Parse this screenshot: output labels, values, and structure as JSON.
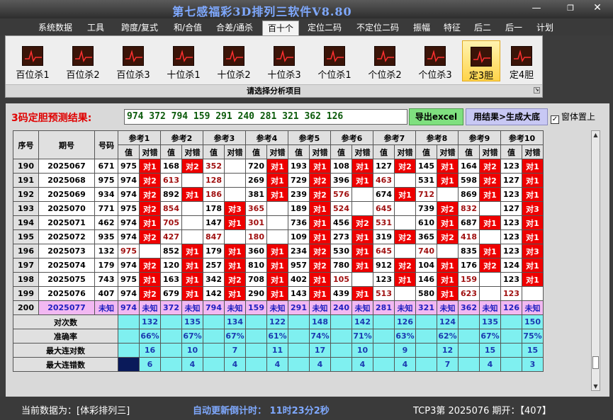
{
  "window": {
    "title": "第七感福彩3D排列三软件V8.80",
    "min": "—",
    "max": "❐",
    "close": "✕"
  },
  "menu": [
    "系统数据",
    "工具",
    "跨度/复式",
    "和/合值",
    "合差/通杀",
    "百十个",
    "定位二码",
    "不定位二码",
    "振幅",
    "特征",
    "后二",
    "后一",
    "计划"
  ],
  "menu_active": 5,
  "toolbar": {
    "items": [
      "百位杀1",
      "百位杀2",
      "百位杀3",
      "十位杀1",
      "十位杀2",
      "十位杀3",
      "个位杀1",
      "个位杀2",
      "个位杀3",
      "定3胆",
      "定4胆"
    ],
    "selected": 9,
    "footer": "请选择分析项目"
  },
  "prediction": {
    "label": "3码定胆预测结果:",
    "value": "974 372 794 159 291 240 281 321 362 126",
    "excel_button": "导出excel",
    "gen_button": "用结果>生成大底",
    "pin_label": "窗体置上",
    "pin_checked": "✓"
  },
  "table": {
    "h_seq": "序号",
    "h_period": "期号",
    "h_code": "号码",
    "refs": [
      "参考1",
      "参考2",
      "参考3",
      "参考4",
      "参考5",
      "参考6",
      "参考7",
      "参考8",
      "参考9",
      "参考10"
    ],
    "sub_val": "值",
    "sub_hit": "对错",
    "rows": [
      {
        "seq": "190",
        "period": "2025067",
        "code": "671",
        "cells": [
          [
            "975",
            "对1"
          ],
          [
            "168",
            "对2"
          ],
          [
            "352",
            ""
          ],
          [
            "720",
            "对1"
          ],
          [
            "193",
            "对1"
          ],
          [
            "108",
            "对1"
          ],
          [
            "127",
            "对2"
          ],
          [
            "145",
            "对1"
          ],
          [
            "164",
            "对2"
          ],
          [
            "123",
            "对1"
          ]
        ]
      },
      {
        "seq": "191",
        "period": "2025068",
        "code": "975",
        "cells": [
          [
            "974",
            "对2"
          ],
          [
            "613",
            ""
          ],
          [
            "128",
            ""
          ],
          [
            "269",
            "对1"
          ],
          [
            "729",
            "对2"
          ],
          [
            "396",
            "对1"
          ],
          [
            "463",
            ""
          ],
          [
            "531",
            "对1"
          ],
          [
            "598",
            "对2"
          ],
          [
            "127",
            "对1"
          ]
        ]
      },
      {
        "seq": "192",
        "period": "2025069",
        "code": "934",
        "cells": [
          [
            "974",
            "对2"
          ],
          [
            "892",
            "对1"
          ],
          [
            "186",
            ""
          ],
          [
            "381",
            "对1"
          ],
          [
            "239",
            "对2"
          ],
          [
            "576",
            ""
          ],
          [
            "674",
            "对1"
          ],
          [
            "712",
            ""
          ],
          [
            "869",
            "对1"
          ],
          [
            "123",
            "对1"
          ]
        ]
      },
      {
        "seq": "193",
        "period": "2025070",
        "code": "771",
        "cells": [
          [
            "975",
            "对2"
          ],
          [
            "854",
            ""
          ],
          [
            "178",
            "对3"
          ],
          [
            "365",
            ""
          ],
          [
            "189",
            "对1"
          ],
          [
            "524",
            ""
          ],
          [
            "645",
            ""
          ],
          [
            "739",
            "对2"
          ],
          [
            "832",
            ""
          ],
          [
            "127",
            "对3"
          ]
        ]
      },
      {
        "seq": "194",
        "period": "2025071",
        "code": "462",
        "cells": [
          [
            "974",
            "对1"
          ],
          [
            "705",
            ""
          ],
          [
            "147",
            "对1"
          ],
          [
            "301",
            ""
          ],
          [
            "736",
            "对1"
          ],
          [
            "456",
            "对2"
          ],
          [
            "531",
            ""
          ],
          [
            "610",
            "对1"
          ],
          [
            "687",
            "对1"
          ],
          [
            "123",
            "对1"
          ]
        ]
      },
      {
        "seq": "195",
        "period": "2025072",
        "code": "935",
        "cells": [
          [
            "974",
            "对2"
          ],
          [
            "427",
            ""
          ],
          [
            "847",
            ""
          ],
          [
            "180",
            ""
          ],
          [
            "109",
            "对1"
          ],
          [
            "273",
            "对1"
          ],
          [
            "319",
            "对2"
          ],
          [
            "365",
            "对2"
          ],
          [
            "418",
            ""
          ],
          [
            "123",
            "对1"
          ]
        ]
      },
      {
        "seq": "196",
        "period": "2025073",
        "code": "132",
        "cells": [
          [
            "975",
            ""
          ],
          [
            "852",
            "对1"
          ],
          [
            "179",
            "对1"
          ],
          [
            "360",
            "对1"
          ],
          [
            "234",
            "对2"
          ],
          [
            "530",
            "对1"
          ],
          [
            "645",
            ""
          ],
          [
            "740",
            ""
          ],
          [
            "835",
            "对1"
          ],
          [
            "123",
            "对3"
          ]
        ]
      },
      {
        "seq": "197",
        "period": "2025074",
        "code": "179",
        "cells": [
          [
            "974",
            "对2"
          ],
          [
            "120",
            "对1"
          ],
          [
            "257",
            "对1"
          ],
          [
            "810",
            "对1"
          ],
          [
            "957",
            "对2"
          ],
          [
            "780",
            "对1"
          ],
          [
            "912",
            "对2"
          ],
          [
            "104",
            "对1"
          ],
          [
            "176",
            "对2"
          ],
          [
            "124",
            "对1"
          ]
        ]
      },
      {
        "seq": "198",
        "period": "2025075",
        "code": "743",
        "cells": [
          [
            "975",
            "对1"
          ],
          [
            "163",
            "对1"
          ],
          [
            "342",
            "对2"
          ],
          [
            "708",
            "对1"
          ],
          [
            "402",
            "对1"
          ],
          [
            "105",
            ""
          ],
          [
            "123",
            "对1"
          ],
          [
            "146",
            "对1"
          ],
          [
            "159",
            ""
          ],
          [
            "123",
            "对1"
          ]
        ]
      },
      {
        "seq": "199",
        "period": "2025076",
        "code": "407",
        "cells": [
          [
            "974",
            "对2"
          ],
          [
            "679",
            "对1"
          ],
          [
            "142",
            "对1"
          ],
          [
            "290",
            "对1"
          ],
          [
            "143",
            "对1"
          ],
          [
            "439",
            "对1"
          ],
          [
            "513",
            ""
          ],
          [
            "580",
            "对1"
          ],
          [
            "623",
            ""
          ],
          [
            "123",
            ""
          ]
        ]
      }
    ],
    "last": {
      "seq": "200",
      "period": "2025077",
      "code": "未知",
      "vals": [
        "974",
        "372",
        "794",
        "159",
        "291",
        "240",
        "281",
        "321",
        "362",
        "126"
      ],
      "unknown": "未知"
    },
    "stats": [
      {
        "label": "对次数",
        "vals": [
          "132",
          "135",
          "134",
          "122",
          "148",
          "142",
          "126",
          "124",
          "135",
          "150"
        ]
      },
      {
        "label": "准确率",
        "vals": [
          "66%",
          "67%",
          "67%",
          "61%",
          "74%",
          "71%",
          "63%",
          "62%",
          "67%",
          "75%"
        ]
      },
      {
        "label": "最大连对数",
        "vals": [
          "16",
          "10",
          "7",
          "11",
          "17",
          "10",
          "9",
          "12",
          "15",
          "15"
        ]
      },
      {
        "label": "最大连错数",
        "vals": [
          "6",
          "4",
          "4",
          "4",
          "4",
          "4",
          "4",
          "7",
          "4",
          "3"
        ]
      }
    ]
  },
  "scroll": {
    "up": "▲",
    "down": "▼"
  },
  "status": {
    "data_source": "当前数据为：[体彩排列三]",
    "countdown": "自动更新倒计时： 11时23分2秒",
    "period_info": "TCP3第 2025076 期开：【407】"
  }
}
